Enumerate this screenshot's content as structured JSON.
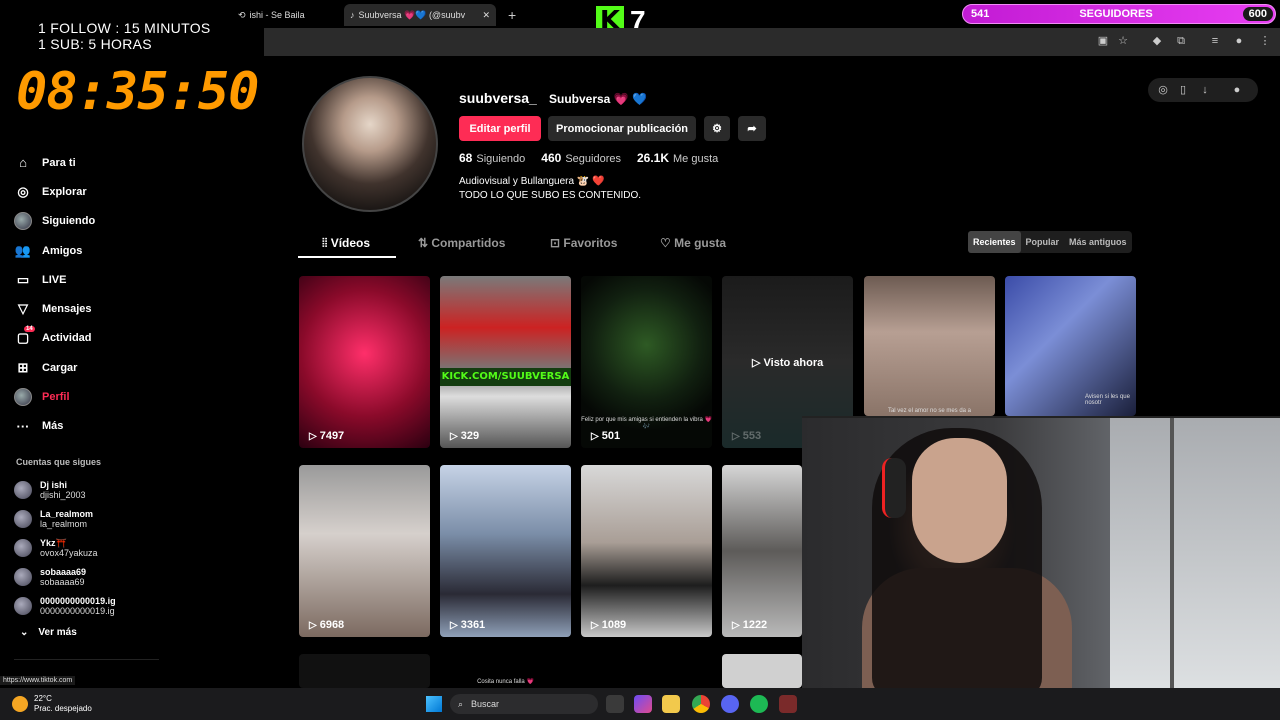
{
  "overlay": {
    "line1": "1 FOLLOW : 15 MINUTOS",
    "line2": "1 SUB: 5 HORAS",
    "timer": "08:35:50",
    "kick_count": "7",
    "followers_bar": {
      "current": "541",
      "label": "SEGUIDORES",
      "goal": "600",
      "progress": 0.9
    }
  },
  "browser": {
    "tabs": [
      {
        "label": "ishi - Se Baila"
      },
      {
        "label": "Suubversa 💗💙 (@suubv"
      }
    ],
    "new_tab": "+"
  },
  "nav": {
    "items": [
      {
        "label": "Para ti",
        "icon": "home-icon"
      },
      {
        "label": "Explorar",
        "icon": "compass-icon"
      },
      {
        "label": "Siguiendo",
        "icon": "following-avatar-icon"
      },
      {
        "label": "Amigos",
        "icon": "friends-icon"
      },
      {
        "label": "LIVE",
        "icon": "live-icon"
      },
      {
        "label": "Mensajes",
        "icon": "messages-icon"
      },
      {
        "label": "Actividad",
        "icon": "activity-icon",
        "badge": "14"
      },
      {
        "label": "Cargar",
        "icon": "upload-icon"
      },
      {
        "label": "Perfil",
        "icon": "profile-avatar-icon",
        "active": true
      },
      {
        "label": "Más",
        "icon": "more-icon"
      }
    ],
    "following_heading": "Cuentas que sigues",
    "following": [
      {
        "name": "Dj ishi",
        "handle": "djishi_2003"
      },
      {
        "name": "La_realmom",
        "handle": "la_realmom"
      },
      {
        "name": "Ykz⛩️",
        "handle": "ovox47yakuza"
      },
      {
        "name": "sobaaaa69",
        "handle": "sobaaaa69"
      },
      {
        "name": "0000000000019.ig",
        "handle": "0000000000019.ig"
      }
    ],
    "see_more": "Ver más",
    "status_url": "https://www.tiktok.com"
  },
  "profile": {
    "username": "suubversa_",
    "nickname": "Suubversa 💗 💙",
    "edit_button": "Editar perfil",
    "promote_button": "Promocionar publicación",
    "following_count": "68",
    "following_label": "Siguiendo",
    "followers_count": "460",
    "followers_label": "Seguidores",
    "likes_count": "26.1K",
    "likes_label": "Me gusta",
    "bio_line1": "Audiovisual y Bullanguera 🐮 ❤️",
    "bio_line2": "TODO LO QUE SUBO ES CONTENIDO."
  },
  "tabs": [
    "Vídeos",
    "Compartidos",
    "Favoritos",
    "Me gusta"
  ],
  "sort": [
    "Recientes",
    "Popular",
    "Más antiguos"
  ],
  "videos_row1": [
    {
      "views": "7497"
    },
    {
      "views": "329",
      "banner": "KICK.COM/SUUBVERSA"
    },
    {
      "views": "501",
      "caption": "Feliz por que mis amigas si entienden la vibra 💗🎶"
    },
    {
      "views": "553",
      "overlay": "Visto ahora"
    },
    {
      "views": "",
      "caption": "Tal vez el amor no se mes da a"
    },
    {
      "views": "",
      "caption": "Avisen si les que nosotr"
    }
  ],
  "videos_row2": [
    {
      "views": "6968"
    },
    {
      "views": "3361"
    },
    {
      "views": "1089"
    },
    {
      "views": "1222"
    }
  ],
  "row3_caption": "Cosita nunca falla 💗",
  "taskbar": {
    "temperature": "22°C",
    "weather": "Prac. despejado",
    "search": "Buscar"
  }
}
